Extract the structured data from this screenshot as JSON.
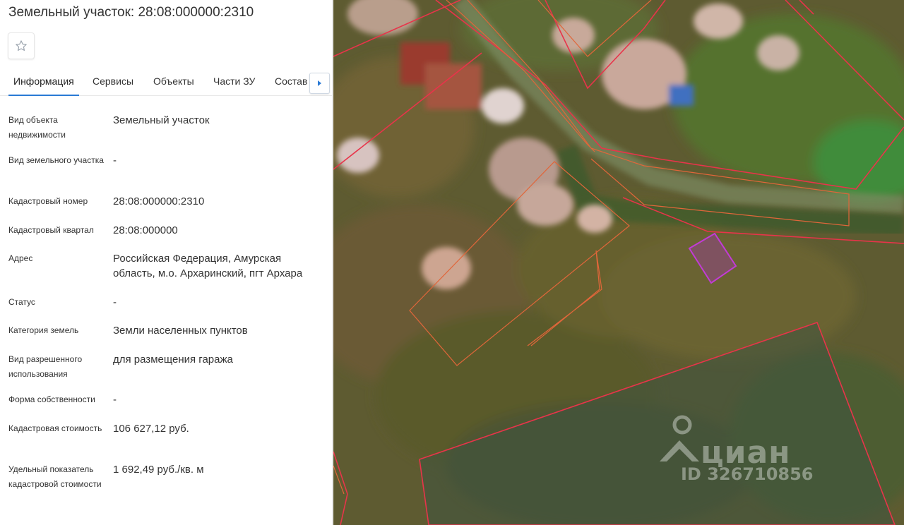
{
  "header": {
    "title": "Земельный участок: 28:08:000000:2310"
  },
  "favorite_icon": "star-outline-icon",
  "tabs": [
    {
      "label": "Информация",
      "active": true
    },
    {
      "label": "Сервисы",
      "active": false
    },
    {
      "label": "Объекты",
      "active": false
    },
    {
      "label": "Части ЗУ",
      "active": false
    },
    {
      "label": "Состав",
      "active": false
    }
  ],
  "tabs_next_icon": "caret-right-icon",
  "accent_color": "#2a7ad5",
  "info": [
    {
      "label": "Вид объекта недвижимости",
      "value": "Земельный участок"
    },
    {
      "label": "Вид земельного участка",
      "value": "-"
    },
    {
      "label": "Кадастровый номер",
      "value": "28:08:000000:2310"
    },
    {
      "label": "Кадастровый квартал",
      "value": "28:08:000000"
    },
    {
      "label": "Адрес",
      "value": "Российская Федерация, Амурская область, м.о. Архаринский, пгт Архара"
    },
    {
      "label": "Статус",
      "value": "-"
    },
    {
      "label": "Категория земель",
      "value": "Земли населенных пунктов"
    },
    {
      "label": "Вид разрешенного использования",
      "value": "для размещения гаража"
    },
    {
      "label": "Форма собственности",
      "value": "-"
    },
    {
      "label": "Кадастровая стоимость",
      "value": "106 627,12 руб."
    },
    {
      "label": "Удельный показатель кадастровой стоимости",
      "value": "1 692,49 руб./кв. м"
    }
  ],
  "map": {
    "watermark_brand": "циан",
    "watermark_id": "ID 326710856",
    "parcel_border_color": "#e8344a",
    "selected_parcel_color": "#c23bd6",
    "building_outline_color": "#e0663a"
  }
}
